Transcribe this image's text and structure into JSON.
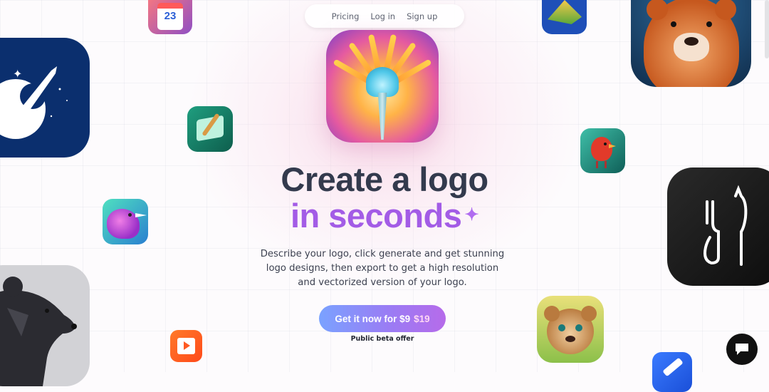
{
  "nav": {
    "pricing": "Pricing",
    "login": "Log in",
    "signup": "Sign up"
  },
  "hero": {
    "title_line1": "Create a logo",
    "title_line2": "in seconds",
    "sparkle": "✦",
    "description": "Describe your logo, click generate and get stunning logo designs, then export to get a high resolution and vectorized version of your logo."
  },
  "cta": {
    "label": "Get it now for $9",
    "old_price": "$19",
    "note": "Public beta offer"
  },
  "calendar_icon": {
    "day": "23"
  },
  "colors": {
    "headline": "#333a4d",
    "accent": "#a35ce6",
    "button_start": "#7aa2ff",
    "button_end": "#b66bea"
  }
}
